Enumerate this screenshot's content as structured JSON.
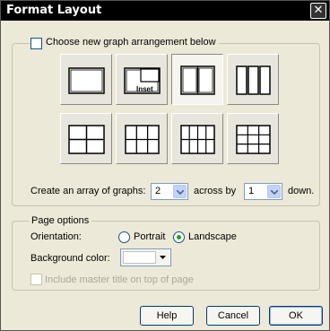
{
  "window": {
    "title": "Format Layout",
    "close_glyph": "✕"
  },
  "arrangement": {
    "checkbox_label": "Choose new graph arrangement below",
    "checked": false,
    "inset_label": "Inset",
    "tiles": [
      {
        "id": "single",
        "selected": false
      },
      {
        "id": "inset",
        "selected": false
      },
      {
        "id": "two-columns",
        "selected": true
      },
      {
        "id": "three-columns",
        "selected": false
      },
      {
        "id": "two-by-two",
        "selected": false
      },
      {
        "id": "three-by-two",
        "selected": false
      },
      {
        "id": "four-by-two",
        "selected": false
      },
      {
        "id": "three-by-three",
        "selected": false
      }
    ],
    "array_label": "Create an array of graphs:",
    "across_value": "2",
    "across_label": "across by",
    "down_value": "1",
    "down_label": "down."
  },
  "page_options": {
    "legend": "Page options",
    "orientation_label": "Orientation:",
    "portrait_label": "Portrait",
    "landscape_label": "Landscape",
    "orientation_selected": "Landscape",
    "background_label": "Background color:",
    "background_color": "#ffffff",
    "master_title_label": "Include master title on top of page",
    "master_title_enabled": false
  },
  "buttons": {
    "help": "Help",
    "cancel": "Cancel",
    "ok": "OK"
  },
  "colors": {
    "radio_dot": "#21a121",
    "title_bar": "#000000",
    "dialog_bg": "#ece9d8"
  }
}
